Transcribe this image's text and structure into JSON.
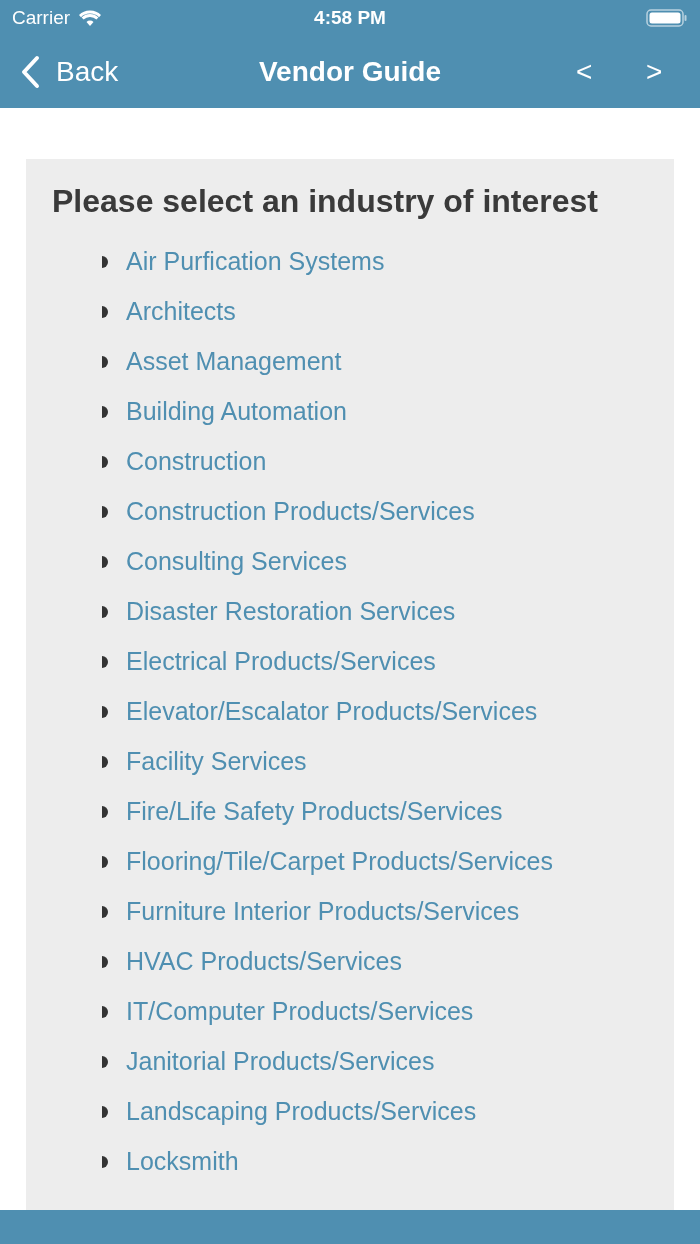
{
  "status_bar": {
    "carrier": "Carrier",
    "time": "4:58 PM"
  },
  "nav_bar": {
    "back": "Back",
    "title": "Vendor Guide",
    "prev": "<",
    "next": ">"
  },
  "heading": "Please select an industry of interest",
  "industries": [
    {
      "label": "Air Purfication Systems"
    },
    {
      "label": "Architects"
    },
    {
      "label": "Asset Management"
    },
    {
      "label": "Building Automation"
    },
    {
      "label": "Construction"
    },
    {
      "label": "Construction Products/Services"
    },
    {
      "label": "Consulting Services"
    },
    {
      "label": "Disaster Restoration Services"
    },
    {
      "label": "Electrical Products/Services"
    },
    {
      "label": "Elevator/Escalator Products/Services"
    },
    {
      "label": "Facility Services"
    },
    {
      "label": "Fire/Life Safety Products/Services"
    },
    {
      "label": "Flooring/Tile/Carpet Products/Services"
    },
    {
      "label": "Furniture Interior Products/Services"
    },
    {
      "label": "HVAC Products/Services"
    },
    {
      "label": "IT/Computer Products/Services"
    },
    {
      "label": "Janitorial Products/Services"
    },
    {
      "label": "Landscaping Products/Services"
    },
    {
      "label": "Locksmith"
    }
  ]
}
